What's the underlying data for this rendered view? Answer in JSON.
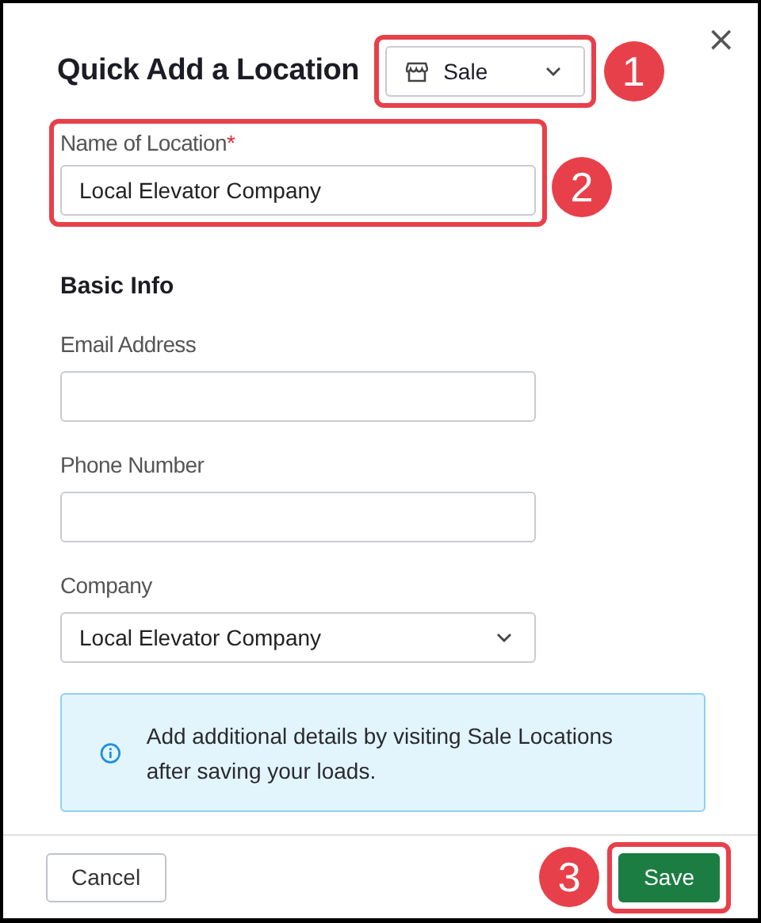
{
  "dialog": {
    "title": "Quick Add a Location",
    "close": "×",
    "type_dropdown": {
      "value": "Sale",
      "callout": "1"
    },
    "name_field": {
      "label": "Name of Location",
      "required_mark": "*",
      "value": "Local Elevator Company",
      "callout": "2"
    },
    "section_title": "Basic Info",
    "fields": [
      {
        "kind": "text",
        "label": "Email Address"
      },
      {
        "kind": "text",
        "label": "Phone Number"
      },
      {
        "kind": "select",
        "label": "Company",
        "value": "Local Elevator Company"
      }
    ],
    "info": "Add additional details by visiting Sale Locations after saving your loads.",
    "buttons": [
      {
        "kind": "secondary",
        "label": "Cancel"
      },
      {
        "kind": "primary",
        "label": "Save",
        "callout": "3"
      }
    ]
  }
}
